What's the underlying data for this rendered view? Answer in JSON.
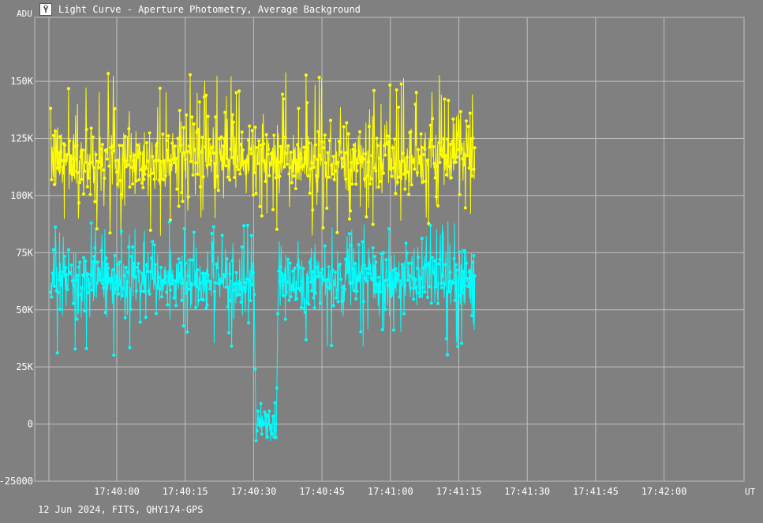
{
  "window": {
    "title": "Light Curve - Aperture Photometry, Average Background",
    "footer": "12 Jun 2024, FITS, QHY174-GPS"
  },
  "colors": {
    "background": "#808080",
    "grid": "#c0c0c0",
    "series_target": "#ffff00",
    "series_comparison": "#00ffff"
  },
  "chart_data": {
    "type": "line",
    "title": "Light Curve - Aperture Photometry, Average Background",
    "xlabel": "UT",
    "ylabel": "ADU",
    "x_ticks": [
      "17:40:00",
      "17:40:15",
      "17:40:30",
      "17:40:45",
      "17:41:00",
      "17:41:15",
      "17:41:30",
      "17:41:45",
      "17:42:00"
    ],
    "y_ticks": [
      "150K",
      "125K",
      "100K",
      "75K",
      "50K",
      "25K",
      "0",
      "-25000"
    ],
    "ylim": [
      -25000,
      178000
    ],
    "xlim_seconds_from_start": [
      0,
      93
    ],
    "grid": true,
    "series": [
      {
        "color": "#ffff00",
        "profile": "noisy constant",
        "x_range_seconds_from_start": [
          0,
          93
        ],
        "baseline": 116000,
        "scatter_core": 8000,
        "spikes_high_max": 154000,
        "spikes_low_min": 82000
      },
      {
        "color": "#00ffff",
        "profile": "noisy constant with occultation dip",
        "x_range_seconds_from_start": [
          0,
          93
        ],
        "baseline": 63000,
        "scatter_core": 7000,
        "spikes_high_max": 89000,
        "spikes_low_min": 30000,
        "dip": {
          "start_seconds": 45.0,
          "end_seconds": 49.5,
          "level": 0,
          "scatter": 4500,
          "min": -15000
        }
      }
    ]
  }
}
